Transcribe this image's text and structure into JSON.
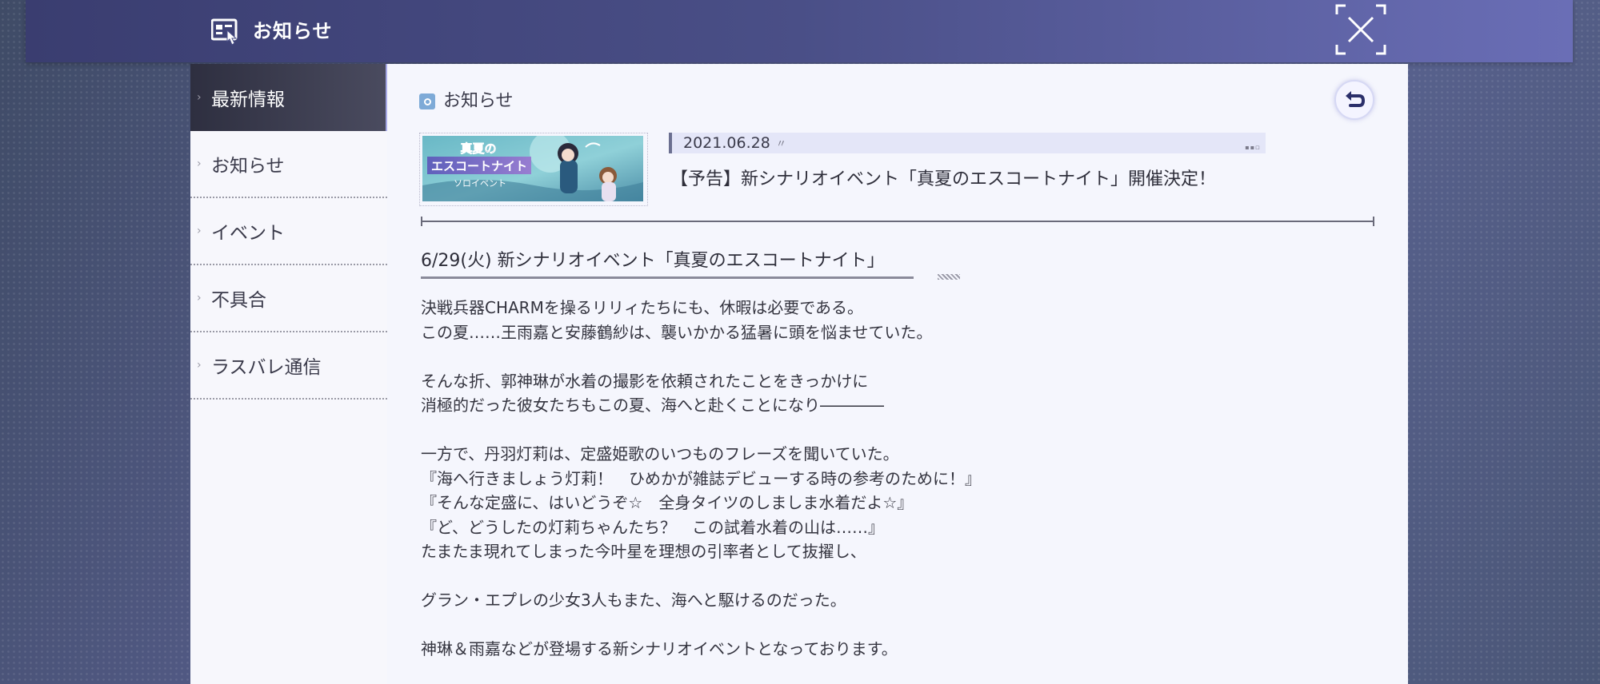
{
  "header": {
    "title": "お知らせ",
    "icon": "notice-board-icon",
    "close_icon": "close-icon"
  },
  "sidebar": {
    "items": [
      {
        "label": "最新情報",
        "active": true
      },
      {
        "label": "お知らせ"
      },
      {
        "label": "イベント"
      },
      {
        "label": "不具合"
      },
      {
        "label": "ラスバレ通信"
      }
    ]
  },
  "content": {
    "section_title": "お知らせ",
    "back_icon": "undo-icon",
    "banner": {
      "line1": "真夏の",
      "line2": "エスコートナイト",
      "line3": "ソロイベント"
    },
    "date": "2021.06.28",
    "post_title": "【予告】新シナリオイベント「真夏のエスコートナイト」開催決定！",
    "subtitle": "6/29(火) 新シナリオイベント「真夏のエスコートナイト」",
    "body": [
      "決戦兵器CHARMを操るリリィたちにも、休暇は必要である。",
      "この夏……王雨嘉と安藤鶴紗は、襲いかかる猛暑に頭を悩ませていた。",
      "",
      "そんな折、郭神琳が水着の撮影を依頼されたことをきっかけに",
      "消極的だった彼女たちもこの夏、海へと赴くことになり――――",
      "",
      "一方で、丹羽灯莉は、定盛姫歌のいつものフレーズを聞いていた。",
      "『海へ行きましょう灯莉！　ひめかが雑誌デビューする時の参考のために！』",
      "『そんな定盛に、はいどうぞ☆　全身タイツのしましま水着だよ☆』",
      "『ど、どうしたの灯莉ちゃんたち？　この試着水着の山は……』",
      "たまたま現れてしまった今叶星を理想の引率者として抜擢し、",
      "",
      "グラン・エプレの少女3人もまた、海へと駆けるのだった。",
      "",
      "神琳＆雨嘉などが登場する新シナリオイベントとなっております。"
    ]
  }
}
